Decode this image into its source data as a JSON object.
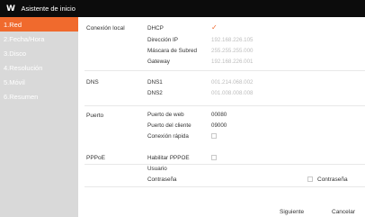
{
  "window": {
    "logo": "W",
    "title": "Asistente de inicio"
  },
  "sidebar": {
    "items": [
      {
        "label": "1.Red",
        "active": true
      },
      {
        "label": "2.Fecha/Hora"
      },
      {
        "label": "3.Disco"
      },
      {
        "label": "4.Resolución"
      },
      {
        "label": "5.Móvil"
      },
      {
        "label": "6.Resumen"
      }
    ]
  },
  "local": {
    "title": "Conexión local",
    "dhcp_label": "DHCP",
    "dhcp_checked": true,
    "ip_label": "Dirección IP",
    "ip_value": "192.168.226.105",
    "mask_label": "Máscara de Subred",
    "mask_value": "255.255.255.000",
    "gateway_label": "Gateway",
    "gateway_value": "192.168.226.001"
  },
  "dns": {
    "title": "DNS",
    "dns1_label": "DNS1",
    "dns1_value": "001.214.068.002",
    "dns2_label": "DNS2",
    "dns2_value": "001.008.008.008"
  },
  "port": {
    "title": "Puerto",
    "web_label": "Puerto de web",
    "web_value": "00080",
    "client_label": "Puerto del cliente",
    "client_value": "09000",
    "fast_label": "Conexión rápida"
  },
  "pppoe": {
    "title": "PPPoE",
    "enable_label": "Habilitar PPPOE",
    "user_label": "Usuario",
    "password_label": "Contraseña",
    "show_password_label": "Contraseña"
  },
  "footer": {
    "next_label": "Siguiente",
    "cancel_label": "Cancelar"
  },
  "colors": {
    "accent": "#f06a2d",
    "titlebar": "#0c0c0c",
    "sidebar": "#d9d9d9"
  }
}
